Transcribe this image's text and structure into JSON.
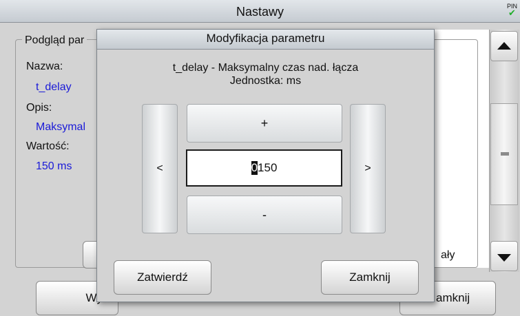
{
  "window": {
    "title": "Nastawy",
    "pin_label": "PIN"
  },
  "panel": {
    "group_title": "Podgląd par",
    "name_label": "Nazwa:",
    "name_value": "t_delay",
    "desc_label": "Opis:",
    "desc_value": "Maksymal",
    "value_label": "Wartość:",
    "value_value": "150 ms"
  },
  "list": {
    "partial_item": "ały"
  },
  "buttons": {
    "send": "Wyśli",
    "close_main": "amknij"
  },
  "dialog": {
    "title": "Modyfikacja parametru",
    "description": "t_delay - Maksymalny czas nad. łącza",
    "unit": "Jednostka: ms",
    "left_label": "<",
    "right_label": ">",
    "plus_label": "+",
    "minus_label": "-",
    "value_cursor_digit": "0",
    "value_rest": "150",
    "confirm_label": "Zatwierdź",
    "close_label": "Zamknij"
  },
  "colors": {
    "value_text": "#1a1ad8",
    "pin_check": "#1fae2a"
  }
}
